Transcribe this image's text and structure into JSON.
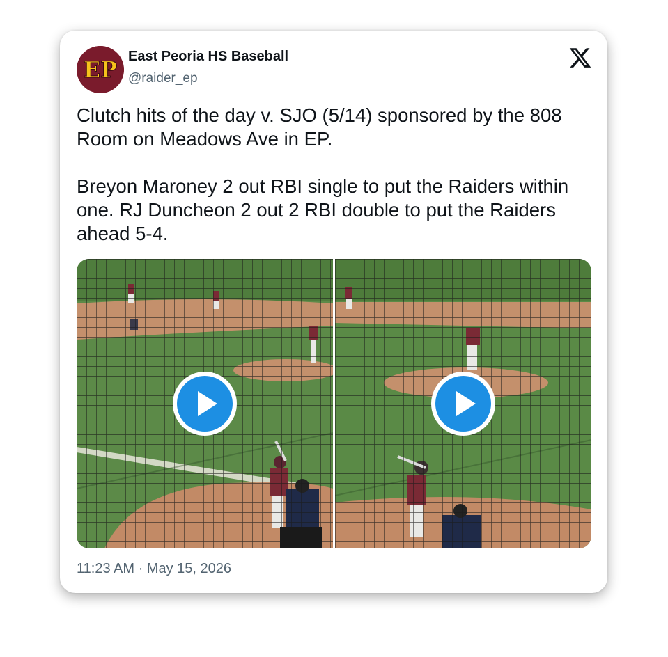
{
  "tweet": {
    "author": {
      "display_name": "East Peoria HS Baseball",
      "handle": "@raider_ep",
      "avatar_text": "EP",
      "avatar_bg": "#7a1b2c",
      "avatar_fg": "#f6c21b"
    },
    "platform_icon": "x-logo-icon",
    "text": {
      "paragraph_1": "Clutch hits of the day v. SJO (5/14) sponsored by the 808 Room on Meadows Ave in EP.",
      "paragraph_2": "Breyon Maroney 2 out RBI single to put the Raiders within one. RJ Duncheon 2 out 2 RBI double to put the Raiders ahead 5-4."
    },
    "media": [
      {
        "type": "video",
        "thumbnail": "baseball-batter-at-plate",
        "icon": "play-icon"
      },
      {
        "type": "video",
        "thumbnail": "baseball-batter-at-plate",
        "icon": "play-icon"
      }
    ],
    "timestamp": "11:23 AM · May 15, 2026"
  },
  "colors": {
    "text": "#0f1419",
    "secondary_text": "#536471",
    "play_button": "#1d9bf0",
    "field_grass": "#5f8a4a",
    "infield_dirt": "#c08a66"
  }
}
